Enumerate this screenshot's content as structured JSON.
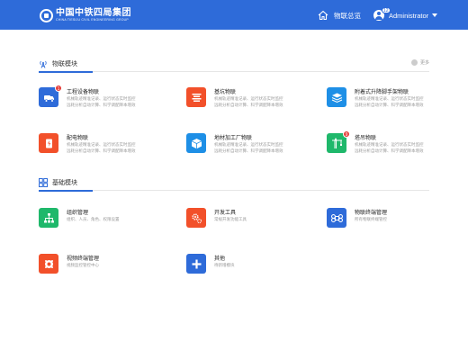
{
  "header": {
    "logo_cn": "中国中铁四局集团",
    "logo_en": "CHINA TIESIJU CIVIL ENGINEERING GROUP",
    "nav_home_label": "物联总览",
    "user_name": "Administrator",
    "user_badge": "12"
  },
  "iot_section": {
    "title": "物联模块",
    "more_label": "更多",
    "cards": [
      {
        "name": "工程设备物联",
        "badge": "1",
        "desc1": "机械轨迹精准记录、运行状态实时监控",
        "desc2": "远耗分析自动计算、科学调配降本增效",
        "icon": "truck-mixer-icon",
        "color": "#2e6bd9"
      },
      {
        "name": "基坑物联",
        "badge": "",
        "desc1": "机械轨迹精准记录、运行状态实时监控",
        "desc2": "远耗分析自动计算、科学调配降本增效",
        "icon": "foundation-pit-icon",
        "color": "#f2502a"
      },
      {
        "name": "附着式升降脚手架物联",
        "badge": "",
        "desc1": "机械轨迹精准记录、运行状态实时监控",
        "desc2": "远耗分析自动计算、科学调配降本增效",
        "icon": "layers-icon",
        "color": "#1e8fe6"
      },
      {
        "name": "配电物联",
        "badge": "",
        "desc1": "机械轨迹精准记录、运行状态实时监控",
        "desc2": "远耗分析自动计算、科学调配降本增效",
        "icon": "power-icon",
        "color": "#f2502a"
      },
      {
        "name": "地材加工厂物联",
        "badge": "",
        "desc1": "机械轨迹精准记录、运行状态实时监控",
        "desc2": "远耗分析自动计算、科学调配降本增效",
        "icon": "cube-icon",
        "color": "#1e8fe6"
      },
      {
        "name": "塔吊物联",
        "badge": "9",
        "desc1": "机械轨迹精准记录、运行状态实时监控",
        "desc2": "远耗分析自动计算、科学调配降本增效",
        "icon": "tower-crane-icon",
        "color": "#1fb86b"
      }
    ]
  },
  "base_section": {
    "title": "基础模块",
    "cards": [
      {
        "name": "组织管理",
        "desc1": "组织、人员、角色、权限设置",
        "icon": "org-chart-icon",
        "color": "#1fb86b"
      },
      {
        "name": "开发工具",
        "desc1": "常规开发功能工具",
        "icon": "gears-icon",
        "color": "#f2502a"
      },
      {
        "name": "物联终端管理",
        "desc1": "所有物联终端管控",
        "icon": "command-icon",
        "color": "#2e6bd9"
      },
      {
        "name": "视频终端管理",
        "desc1": "视频监控管控中心",
        "icon": "camera-icon",
        "color": "#f2502a"
      },
      {
        "name": "其他",
        "desc1": "待新增模块",
        "icon": "plus-icon",
        "color": "#2e6bd9"
      }
    ]
  }
}
